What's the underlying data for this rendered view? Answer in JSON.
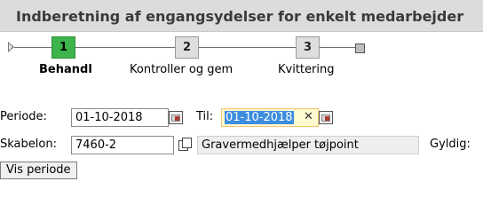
{
  "header": {
    "title": "Indberetning af engangsydelser for enkelt medarbejder"
  },
  "wizard": {
    "steps": [
      {
        "number": "1",
        "label": "Behandl",
        "active": true
      },
      {
        "number": "2",
        "label": "Kontroller og gem",
        "active": false
      },
      {
        "number": "3",
        "label": "Kvittering",
        "active": false
      }
    ]
  },
  "form": {
    "periode_label": "Periode:",
    "periode_value": "01-10-2018",
    "til_label": "Til:",
    "til_value": "01-10-2018",
    "skabelon_label": "Skabelon:",
    "skabelon_value": "7460-2",
    "skabelon_description": "Gravermedhjælper tøjpoint",
    "gyldig_label": "Gyldig:",
    "vis_periode_button": "Vis periode"
  },
  "icons": {
    "calendar": "calendar-icon",
    "clear": "clear-icon",
    "copy": "copy-icon"
  },
  "colors": {
    "active_step": "#3cb44b",
    "inactive_step": "#dedede",
    "selection": "#3c8dde",
    "highlight_field": "#fffbd0"
  }
}
